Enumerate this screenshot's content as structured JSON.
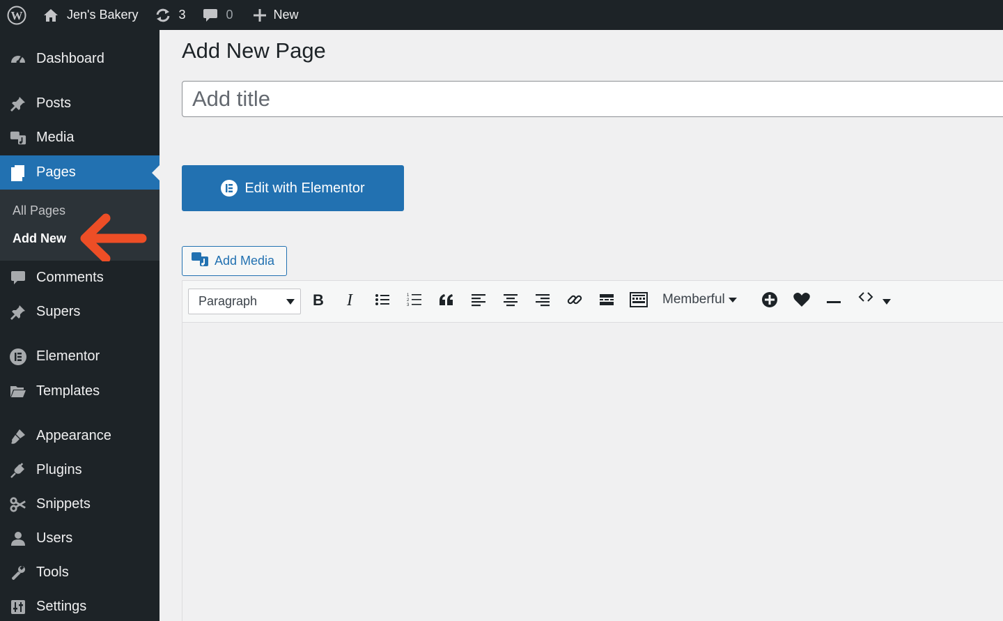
{
  "adminbar": {
    "site_name": "Jen's Bakery",
    "updates_count": "3",
    "comments_count": "0",
    "new_label": "New"
  },
  "sidebar": {
    "items": [
      {
        "label": "Dashboard",
        "icon": "dashboard-icon"
      },
      {
        "label": "Posts",
        "icon": "pin-icon"
      },
      {
        "label": "Media",
        "icon": "media-icon"
      },
      {
        "label": "Pages",
        "icon": "pages-icon",
        "current": true
      },
      {
        "label": "Comments",
        "icon": "comment-icon"
      },
      {
        "label": "Supers",
        "icon": "pin-icon"
      },
      {
        "label": "Elementor",
        "icon": "elementor-icon"
      },
      {
        "label": "Templates",
        "icon": "folder-icon"
      },
      {
        "label": "Appearance",
        "icon": "brush-icon"
      },
      {
        "label": "Plugins",
        "icon": "plug-icon"
      },
      {
        "label": "Snippets",
        "icon": "scissors-icon"
      },
      {
        "label": "Users",
        "icon": "user-icon"
      },
      {
        "label": "Tools",
        "icon": "wrench-icon"
      },
      {
        "label": "Settings",
        "icon": "sliders-icon"
      }
    ],
    "submenu": [
      {
        "label": "All Pages"
      },
      {
        "label": "Add New",
        "active": true
      }
    ]
  },
  "main": {
    "page_title": "Add New Page",
    "title_placeholder": "Add title",
    "elementor_button": "Edit with Elementor",
    "add_media_button": "Add Media",
    "format_select": "Paragraph",
    "font_menu": "Memberful"
  },
  "colors": {
    "adminbar_bg": "#1d2327",
    "accent": "#2271b1",
    "annotation_arrow": "#ed4e26"
  }
}
